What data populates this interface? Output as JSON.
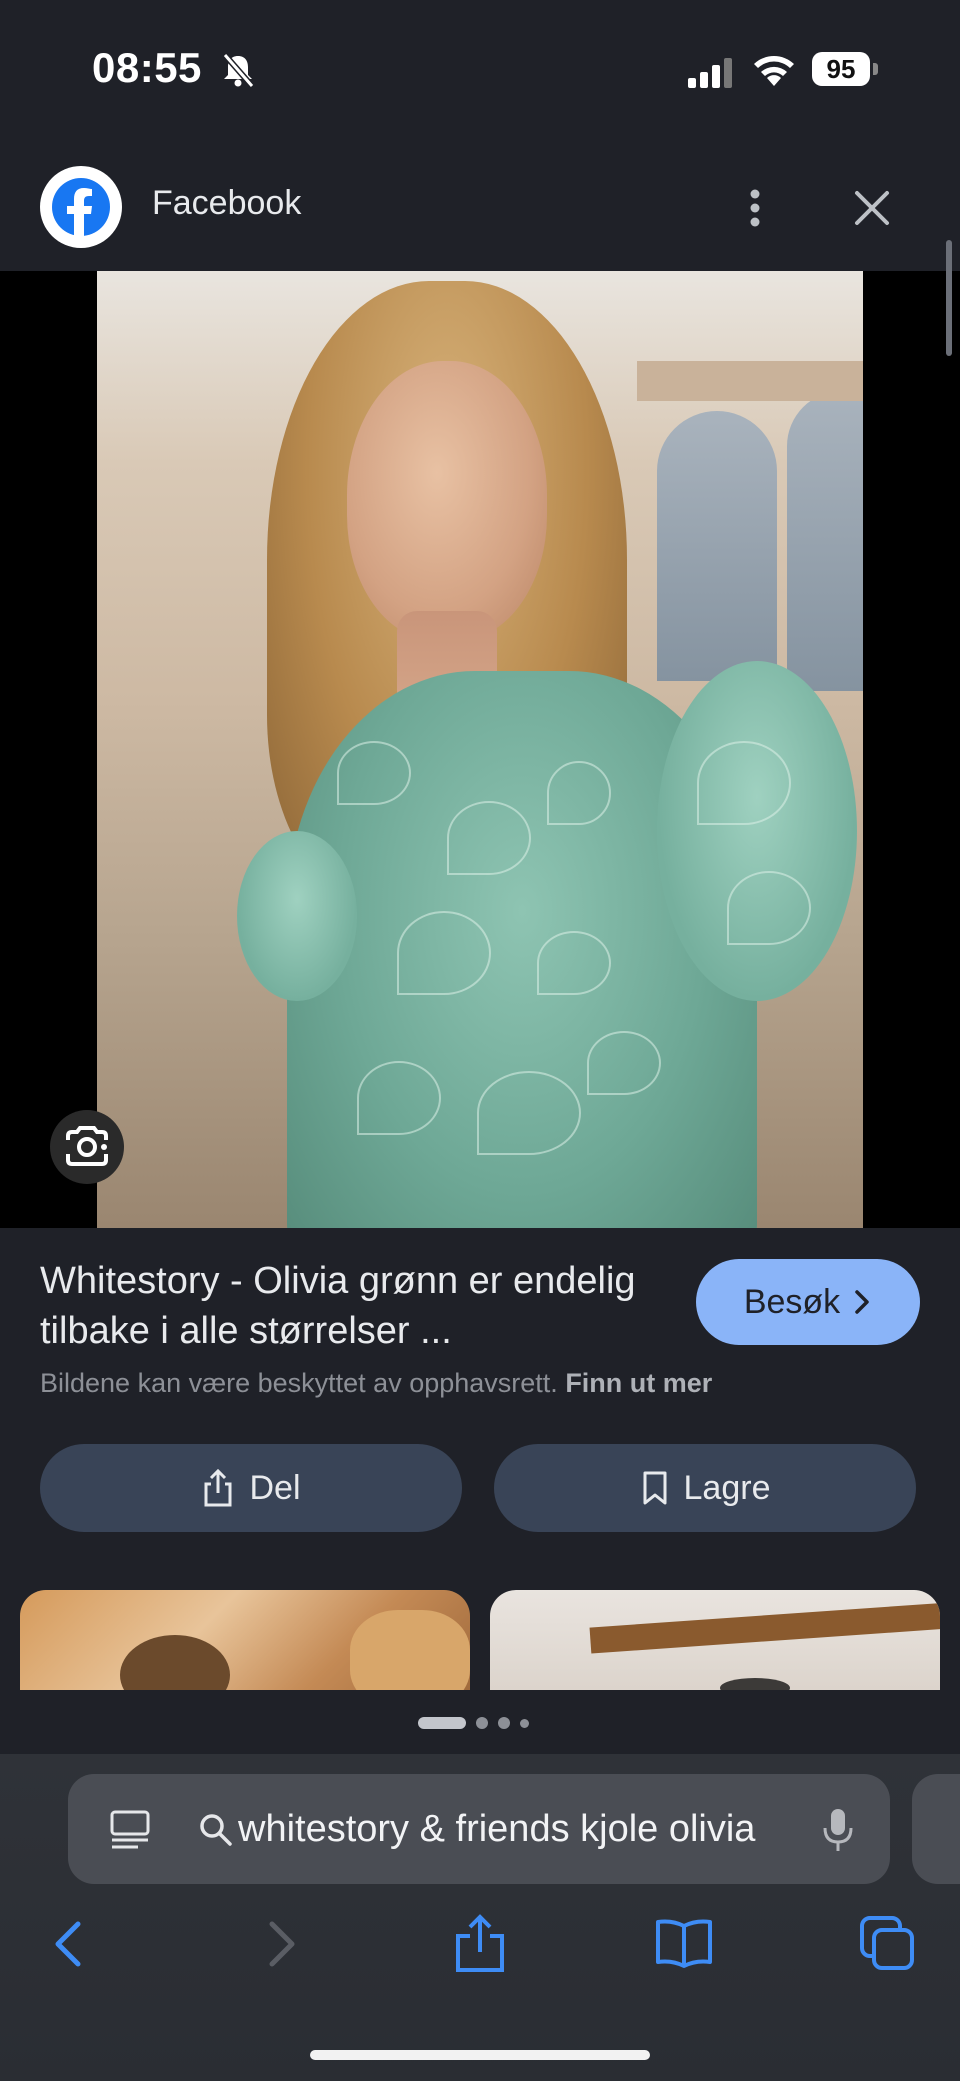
{
  "status": {
    "time": "08:55",
    "battery": "95"
  },
  "header": {
    "title": "Facebook"
  },
  "result": {
    "title": "Whitestory - Olivia grønn er endelig tilbake i alle størrelser ...",
    "visit_label": "Besøk",
    "copyright_text": "Bildene kan være beskyttet av opphavsrett.",
    "learn_more": "Finn ut mer",
    "share_label": "Del",
    "save_label": "Lagre"
  },
  "browser": {
    "url_text": "whitestory & friends kjole olivia"
  },
  "colors": {
    "accent": "#8ab4f8",
    "button_bg": "#394457",
    "background": "#1f2128"
  }
}
